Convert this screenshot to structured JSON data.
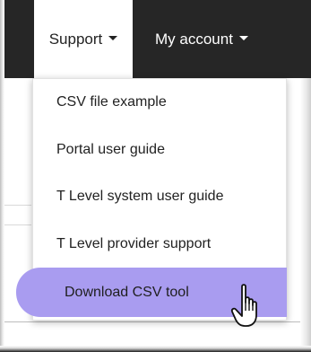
{
  "navbar": {
    "support_label": "Support",
    "account_label": "My account"
  },
  "dropdown": {
    "items": [
      {
        "label": "CSV file example"
      },
      {
        "label": "Portal user guide"
      },
      {
        "label": "T Level system user guide"
      },
      {
        "label": "T Level provider support"
      },
      {
        "label": "Download CSV tool"
      }
    ],
    "highlight_color": "#a99cf0"
  },
  "colors": {
    "navbar_bg": "#262626",
    "active_tab_bg": "#ffffff",
    "text_dark": "#222222",
    "text_light": "#ffffff"
  },
  "icons": {
    "caret": "caret-down-icon",
    "pointer": "hand-pointer-icon"
  }
}
